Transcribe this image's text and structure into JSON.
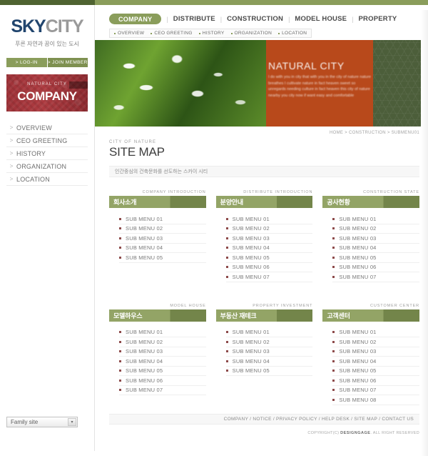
{
  "brand": {
    "logo_sky": "SKY",
    "logo_city": "CITY",
    "tagline": "푸른 자연과 꿈이 있는 도시"
  },
  "auth": {
    "login": "> LOG-IN",
    "join": "> JOIN MEMBER"
  },
  "side_banner": {
    "small": "NATURAL CITY",
    "big": "COMPANY"
  },
  "sidebar": {
    "items": [
      {
        "arrow": ">",
        "label": "OVERVIEW"
      },
      {
        "arrow": ">",
        "label": "CEO GREETING"
      },
      {
        "arrow": ">",
        "label": "HISTORY"
      },
      {
        "arrow": ">",
        "label": "ORGANIZATION"
      },
      {
        "arrow": ">",
        "label": "LOCATION"
      }
    ],
    "family_site": "Family site",
    "family_arrow": "▾"
  },
  "topnav": {
    "active": "COMPANY",
    "separator": "|",
    "items": [
      "DISTRIBUTE",
      "CONSTRUCTION",
      "MODEL HOUSE",
      "PROPERTY"
    ],
    "sub_items": [
      "OVERVIEW",
      "CEO GREETING",
      "HISTORY",
      "ORGANIZATION",
      "LOCATION"
    ]
  },
  "hero": {
    "title": "NATURAL CITY",
    "body": "I do with you in city that with you in the city of nature nature breathes I cultivate nature in fact heaven sweet so unregards needing culture in fact heaven this city of nature nearby you city now if want easy and comfortable"
  },
  "breadcrumb": "HOME > CONSTRUCTION > SUBMENU01",
  "page": {
    "eyebrow": "CITY OF NATURE",
    "title": "SITE MAP",
    "description": "인간중심의 건축문화를 선도하는 스카이 시티"
  },
  "sitemap": {
    "columns": [
      {
        "eyebrow": "COMPANY INTRODUCTION",
        "title": "회사소개",
        "items": [
          "SUB MENU 01",
          "SUB MENU 02",
          "SUB MENU 03",
          "SUB MENU 04",
          "SUB MENU 05"
        ]
      },
      {
        "eyebrow": "DISTRIBUTE INTRODUCTION",
        "title": "분양안내",
        "items": [
          "SUB MENU 01",
          "SUB MENU 02",
          "SUB MENU 03",
          "SUB MENU 04",
          "SUB MENU 05",
          "SUB MENU 06",
          "SUB MENU 07"
        ]
      },
      {
        "eyebrow": "CONSTRUCTION STATE",
        "title": "공사현황",
        "items": [
          "SUB MENU 01",
          "SUB MENU 02",
          "SUB MENU 03",
          "SUB MENU 04",
          "SUB MENU 05",
          "SUB MENU 06",
          "SUB MENU 07"
        ]
      },
      {
        "eyebrow": "MODEL HOUSE",
        "title": "모델하우스",
        "items": [
          "SUB MENU 01",
          "SUB MENU 02",
          "SUB MENU 03",
          "SUB MENU 04",
          "SUB MENU 05",
          "SUB MENU 06",
          "SUB MENU 07"
        ]
      },
      {
        "eyebrow": "PROPERTY INVESTMENT",
        "title": "부동산 재테크",
        "items": [
          "SUB MENU 01",
          "SUB MENU 02",
          "SUB MENU 03",
          "SUB MENU 04",
          "SUB MENU 05"
        ]
      },
      {
        "eyebrow": "CUSTOMER CENTER",
        "title": "고객센터",
        "items": [
          "SUB MENU 01",
          "SUB MENU 02",
          "SUB MENU 03",
          "SUB MENU 04",
          "SUB MENU 05",
          "SUB MENU 06",
          "SUB MENU 07",
          "SUB MENU 08"
        ]
      }
    ]
  },
  "footer": {
    "links": "COMPANY / NOTICE / PRIVACY POLICY / HELP DESK / SITE MAP / CONTACT US",
    "copyright_pre": "COPYRIGHT(C) ",
    "copyright_brand": "DESIGNGAGE",
    "copyright_post": ". ALL RIGHT RESERVED"
  },
  "colors": {
    "green": "#8a9d5b",
    "dark_green": "#4f6331",
    "head_green": "#93a466",
    "head_green_dark": "#73854a",
    "red": "#9e3238",
    "logo_blue": "#21456e"
  }
}
